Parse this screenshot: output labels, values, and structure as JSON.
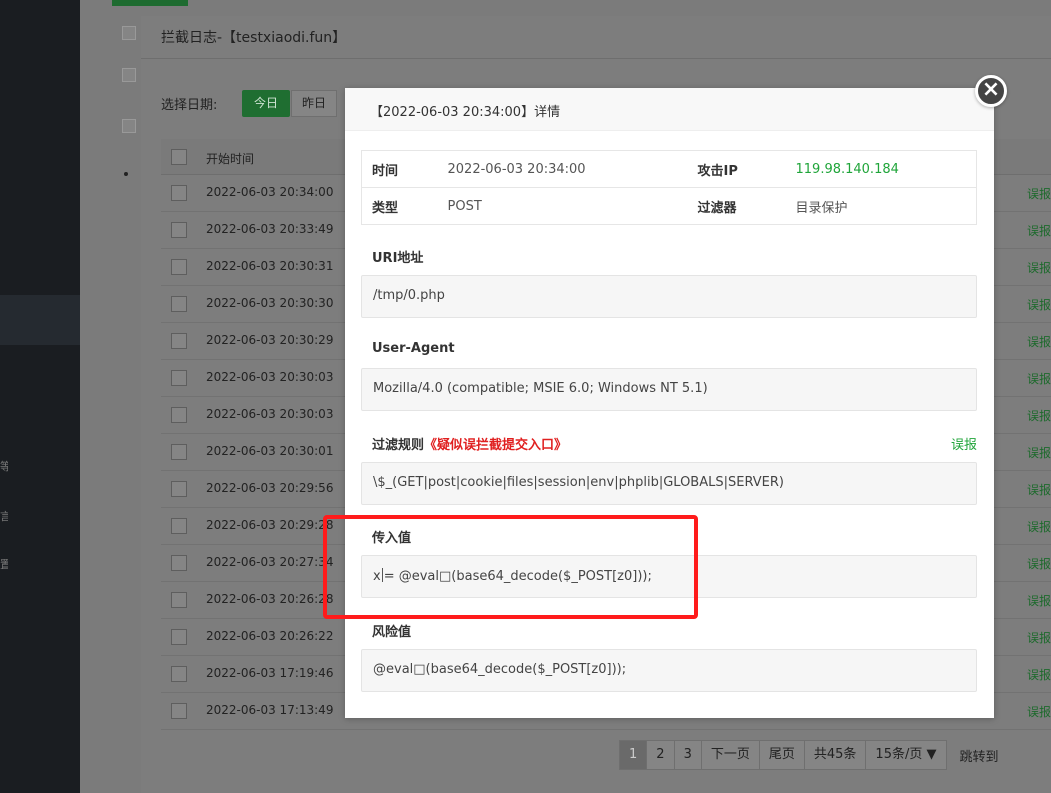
{
  "sidebar": {
    "fragments": [
      "等",
      "言",
      "置"
    ]
  },
  "log_dialog": {
    "title": "拦截日志-【testxiaodi.fun】",
    "date_label": "选择日期:",
    "today_label": "今日",
    "yesterday_label": "昨日",
    "column_header": "开始时间",
    "false_positive_label": "误报",
    "rows": [
      "2022-06-03 20:34:00",
      "2022-06-03 20:33:49",
      "2022-06-03 20:30:31",
      "2022-06-03 20:30:30",
      "2022-06-03 20:30:29",
      "2022-06-03 20:30:03",
      "2022-06-03 20:30:03",
      "2022-06-03 20:30:01",
      "2022-06-03 20:29:56",
      "2022-06-03 20:29:28",
      "2022-06-03 20:27:34",
      "2022-06-03 20:26:28",
      "2022-06-03 20:26:22",
      "2022-06-03 17:19:46",
      "2022-06-03 17:13:49"
    ],
    "pagination": {
      "pages": [
        "1",
        "2",
        "3"
      ],
      "current": "1",
      "next": "下一页",
      "last": "尾页",
      "total": "共45条",
      "page_size": "15条/页",
      "jump_to": "跳转到"
    }
  },
  "detail": {
    "title": "【2022-06-03 20:34:00】详情",
    "close_icon": "close-icon",
    "info": {
      "time_label": "时间",
      "time_value": "2022-06-03 20:34:00",
      "ip_label": "攻击IP",
      "ip_value": "119.98.140.184",
      "type_label": "类型",
      "type_value": "POST",
      "filter_label": "过滤器",
      "filter_value": "目录保护"
    },
    "uri_label": "URI地址",
    "uri_value": "/tmp/0.php",
    "ua_label": "User-Agent",
    "ua_value": "Mozilla/4.0 (compatible; MSIE 6.0; Windows NT 5.1)",
    "rule_label": "过滤规则",
    "rule_warning": "《疑似误拦截提交入口》",
    "rule_false_positive": "误报",
    "rule_value": "\\$_(GET|post|cookie|files|session|env|phplib|GLOBALS|SERVER)",
    "input_label": "传入值",
    "input_value_prefix": "x",
    "input_value_rest": "= @eval□(base64_decode($_POST[z0]));",
    "risk_label": "风险值",
    "risk_value": "@eval□(base64_decode($_POST[z0]));"
  },
  "colors": {
    "accent_green": "#20a53a",
    "warning_red": "#e02020",
    "highlight_box": "#ff1b1b"
  }
}
